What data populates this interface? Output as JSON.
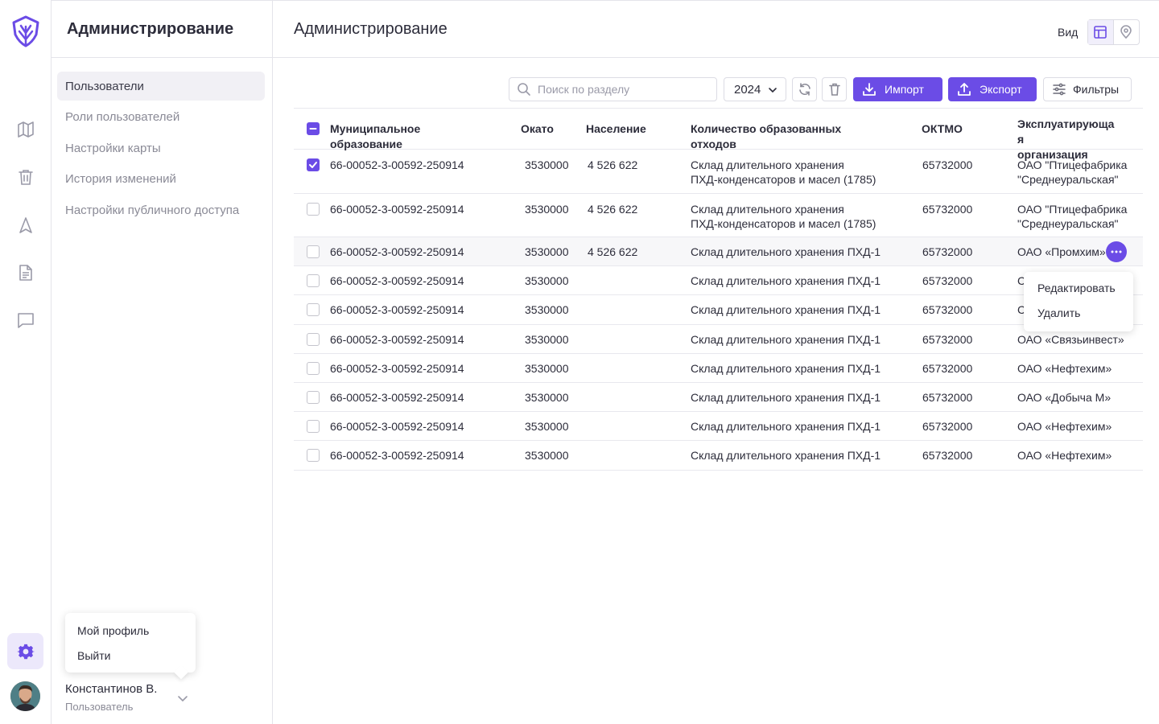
{
  "sidebar": {
    "title": "Администрирование",
    "items": [
      {
        "label": "Пользователи",
        "active": true
      },
      {
        "label": "Роли пользователей"
      },
      {
        "label": "Настройки карты"
      },
      {
        "label": "История изменений"
      },
      {
        "label": "Настройки публичного доступа"
      }
    ]
  },
  "rail": {
    "icons": [
      "logo-icon",
      "map-icon",
      "trash-icon",
      "navigation-icon",
      "document-icon",
      "chat-icon",
      "gear-icon"
    ],
    "accent": "#6b4ce6"
  },
  "profile_menu": {
    "items": [
      "Мой профиль",
      "Выйти"
    ]
  },
  "user": {
    "name": "Константинов В.",
    "role": "Пользователь"
  },
  "header": {
    "title": "Администрирование",
    "view_label": "Вид"
  },
  "toolbar": {
    "search_placeholder": "Поиск по разделу",
    "year": "2024",
    "import_label": "Импорт",
    "export_label": "Экспорт",
    "filters_label": "Фильтры"
  },
  "table": {
    "columns": [
      "Муниципальное образование",
      "Окато",
      "Население",
      "Количество образованных отходов",
      "ОКТМО",
      "Эксплуатирующая организация"
    ],
    "column_line_breaks": {
      "mo": [
        "Муниципальное",
        "образование"
      ],
      "waste": [
        "Количество образованных",
        "отходов"
      ],
      "org": [
        "Эксплуатирующа",
        "я",
        "организация"
      ]
    },
    "rows": [
      {
        "mo": "66-00052-3-00592-250914",
        "okato": "3530000",
        "population": "4 526 622",
        "waste": [
          "Склад длительного хранения",
          "ПХД-конденсаторов и масел (1785)"
        ],
        "oktmo": "65732000",
        "org": [
          "ОАО \"Птицефабрика",
          "\"Среднеуральская\""
        ],
        "checked": true
      },
      {
        "mo": "66-00052-3-00592-250914",
        "okato": "3530000",
        "population": "4 526 622",
        "waste": [
          "Склад длительного хранения",
          "ПХД-конденсаторов и масел (1785)"
        ],
        "oktmo": "65732000",
        "org": [
          "ОАО \"Птицефабрика",
          "\"Среднеуральская\""
        ],
        "checked": false
      },
      {
        "mo": "66-00052-3-00592-250914",
        "okato": "3530000",
        "population": "4 526 622",
        "waste": [
          "Склад длительного хранения ПХД-1"
        ],
        "oktmo": "65732000",
        "org": [
          "ОАО «Промхим»"
        ],
        "checked": false,
        "hover": true
      },
      {
        "mo": "66-00052-3-00592-250914",
        "okato": "3530000",
        "population": "",
        "waste": [
          "Склад длительного хранения ПХД-1"
        ],
        "oktmo": "65732000",
        "org": [
          "С"
        ],
        "checked": false
      },
      {
        "mo": "66-00052-3-00592-250914",
        "okato": "3530000",
        "population": "",
        "waste": [
          "Склад длительного хранения ПХД-1"
        ],
        "oktmo": "65732000",
        "org": [
          "С"
        ],
        "checked": false
      },
      {
        "mo": "66-00052-3-00592-250914",
        "okato": "3530000",
        "population": "",
        "waste": [
          "Склад длительного хранения ПХД-1"
        ],
        "oktmo": "65732000",
        "org": [
          "ОАО «Связьинвест»"
        ],
        "checked": false
      },
      {
        "mo": "66-00052-3-00592-250914",
        "okato": "3530000",
        "population": "",
        "waste": [
          "Склад длительного хранения ПХД-1"
        ],
        "oktmo": "65732000",
        "org": [
          "ОАО «Нефтехим»"
        ],
        "checked": false
      },
      {
        "mo": "66-00052-3-00592-250914",
        "okato": "3530000",
        "population": "",
        "waste": [
          "Склад длительного хранения ПХД-1"
        ],
        "oktmo": "65732000",
        "org": [
          "ОАО «Добыча М»"
        ],
        "checked": false
      },
      {
        "mo": "66-00052-3-00592-250914",
        "okato": "3530000",
        "population": "",
        "waste": [
          "Склад длительного хранения ПХД-1"
        ],
        "oktmo": "65732000",
        "org": [
          "ОАО «Нефтехим»"
        ],
        "checked": false
      },
      {
        "mo": "66-00052-3-00592-250914",
        "okato": "3530000",
        "population": "",
        "waste": [
          "Склад длительного хранения ПХД-1"
        ],
        "oktmo": "65732000",
        "org": [
          "ОАО «Нефтехим»"
        ],
        "checked": false
      }
    ]
  },
  "row_menu": {
    "items": [
      "Редактировать",
      "Удалить"
    ]
  }
}
